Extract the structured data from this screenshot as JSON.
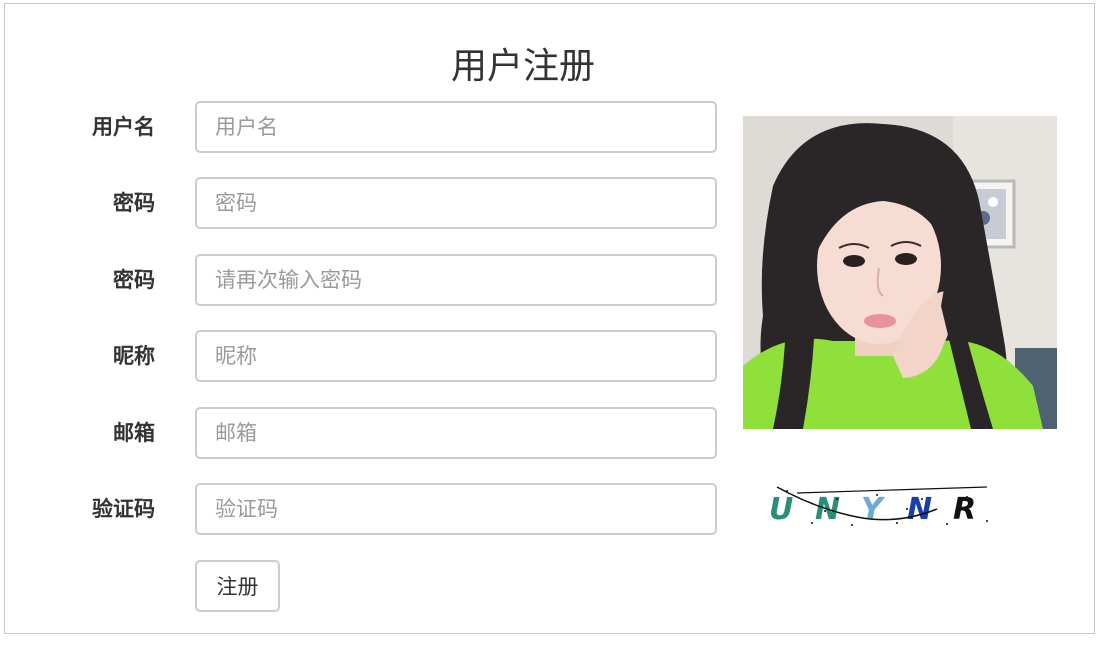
{
  "form": {
    "title": "用户注册",
    "fields": [
      {
        "label": "用户名",
        "placeholder": "用户名",
        "value": ""
      },
      {
        "label": "密码",
        "placeholder": "密码",
        "value": ""
      },
      {
        "label": "密码",
        "placeholder": "请再次输入密码",
        "value": ""
      },
      {
        "label": "昵称",
        "placeholder": "昵称",
        "value": ""
      },
      {
        "label": "邮箱",
        "placeholder": "邮箱",
        "value": ""
      },
      {
        "label": "验证码",
        "placeholder": "验证码",
        "value": ""
      }
    ],
    "submit_label": "注册"
  },
  "captcha": {
    "text": "UNYNR",
    "colors": [
      "#2a8f7a",
      "#2a8f7a",
      "#6fa9d6",
      "#1b3fa8",
      "#111111"
    ]
  },
  "colors": {
    "border": "#cccccc",
    "label": "#333333",
    "placeholder": "#9a9a9a",
    "avatar_sweater": "#8fe03a"
  }
}
